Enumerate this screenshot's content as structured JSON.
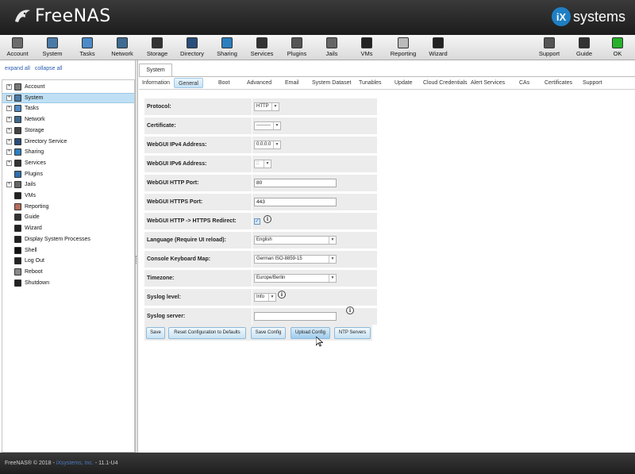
{
  "header": {
    "app_name": "FreeNAS",
    "vendor_name": "systems",
    "vendor_badge": "iX"
  },
  "toolbar": {
    "items": [
      {
        "label": "Account",
        "icon": "account-icon",
        "color": "#6b6b6b"
      },
      {
        "label": "System",
        "icon": "system-icon",
        "color": "#4a7aa8"
      },
      {
        "label": "Tasks",
        "icon": "tasks-icon",
        "color": "#4c8bc8"
      },
      {
        "label": "Network",
        "icon": "network-icon",
        "color": "#3d6b91"
      },
      {
        "label": "Storage",
        "icon": "storage-icon",
        "color": "#333333"
      },
      {
        "label": "Directory",
        "icon": "directory-icon",
        "color": "#2a4d7a"
      },
      {
        "label": "Sharing",
        "icon": "sharing-icon",
        "color": "#2b7ebf"
      },
      {
        "label": "Services",
        "icon": "services-icon",
        "color": "#333333"
      },
      {
        "label": "Plugins",
        "icon": "plugins-icon",
        "color": "#555555"
      },
      {
        "label": "Jails",
        "icon": "jails-icon",
        "color": "#666666"
      },
      {
        "label": "VMs",
        "icon": "vms-icon",
        "color": "#222222"
      },
      {
        "label": "Reporting",
        "icon": "reporting-icon",
        "color": "#bbbbbb"
      },
      {
        "label": "Wizard",
        "icon": "wizard-icon",
        "color": "#222222"
      },
      {
        "label": "Support",
        "icon": "support-icon",
        "color": "#555555"
      },
      {
        "label": "Guide",
        "icon": "guide-icon",
        "color": "#333333"
      },
      {
        "label": "OK",
        "icon": "ok-status-icon",
        "color": "#27b12b"
      }
    ]
  },
  "tree": {
    "expand_all": "expand all",
    "collapse_all": "collapse all",
    "items": [
      {
        "label": "Account",
        "expandable": true,
        "icon": "account-icon",
        "color": "#777777"
      },
      {
        "label": "System",
        "expandable": true,
        "icon": "system-icon",
        "color": "#4a7aa8",
        "selected": true
      },
      {
        "label": "Tasks",
        "expandable": true,
        "icon": "tasks-icon",
        "color": "#4c8bc8"
      },
      {
        "label": "Network",
        "expandable": true,
        "icon": "network-icon",
        "color": "#3d6b91"
      },
      {
        "label": "Storage",
        "expandable": true,
        "icon": "storage-icon",
        "color": "#444444"
      },
      {
        "label": "Directory Service",
        "expandable": true,
        "icon": "directory-icon",
        "color": "#2a4d7a"
      },
      {
        "label": "Sharing",
        "expandable": true,
        "icon": "sharing-icon",
        "color": "#2b7ebf"
      },
      {
        "label": "Services",
        "expandable": true,
        "icon": "services-icon",
        "color": "#333333"
      },
      {
        "label": "Plugins",
        "expandable": false,
        "icon": "plugins-icon",
        "color": "#2f6fae"
      },
      {
        "label": "Jails",
        "expandable": true,
        "icon": "jails-icon",
        "color": "#666666"
      },
      {
        "label": "VMs",
        "expandable": false,
        "icon": "vms-icon",
        "color": "#222222"
      },
      {
        "label": "Reporting",
        "expandable": false,
        "icon": "reporting-icon",
        "color": "#b56b5a"
      },
      {
        "label": "Guide",
        "expandable": false,
        "icon": "guide-icon",
        "color": "#333333"
      },
      {
        "label": "Wizard",
        "expandable": false,
        "icon": "wizard-icon",
        "color": "#222222"
      },
      {
        "label": "Display System Processes",
        "expandable": false,
        "icon": "processes-icon",
        "color": "#222222"
      },
      {
        "label": "Shell",
        "expandable": false,
        "icon": "shell-icon",
        "color": "#111111"
      },
      {
        "label": "Log Out",
        "expandable": false,
        "icon": "logout-icon",
        "color": "#222222"
      },
      {
        "label": "Reboot",
        "expandable": false,
        "icon": "reboot-icon",
        "color": "#888888"
      },
      {
        "label": "Shutdown",
        "expandable": false,
        "icon": "shutdown-icon",
        "color": "#222222"
      }
    ]
  },
  "main": {
    "top_tab": "System",
    "subtabs": [
      {
        "label": "Information"
      },
      {
        "label": "General",
        "active": true
      },
      {
        "label": "Boot"
      },
      {
        "label": "Advanced"
      },
      {
        "label": "Email"
      },
      {
        "label": "System Dataset"
      },
      {
        "label": "Tunables"
      },
      {
        "label": "Update"
      },
      {
        "label": "Cloud Credentials"
      },
      {
        "label": "Alert Services"
      },
      {
        "label": "CAs"
      },
      {
        "label": "Certificates"
      },
      {
        "label": "Support"
      }
    ]
  },
  "form": {
    "protocol": {
      "label": "Protocol:",
      "value": "HTTP"
    },
    "certificate": {
      "label": "Certificate:",
      "value": "---------"
    },
    "ipv4": {
      "label": "WebGUI IPv4 Address:",
      "value": "0.0.0.0"
    },
    "ipv6": {
      "label": "WebGUI IPv6 Address:",
      "value": "::"
    },
    "http_port": {
      "label": "WebGUI HTTP Port:",
      "value": "80"
    },
    "https_port": {
      "label": "WebGUI HTTPS Port:",
      "value": "443"
    },
    "redirect": {
      "label": "WebGUI HTTP -> HTTPS Redirect:",
      "checked": true,
      "check_glyph": "✓"
    },
    "language": {
      "label": "Language (Require UI reload):",
      "value": "English"
    },
    "keyboard": {
      "label": "Console Keyboard Map:",
      "value": "German ISO-8859-15"
    },
    "timezone": {
      "label": "Timezone:",
      "value": "Europe/Berlin"
    },
    "syslog_level": {
      "label": "Syslog level:",
      "value": "Info"
    },
    "syslog_server": {
      "label": "Syslog server:",
      "value": ""
    }
  },
  "buttons": {
    "save": "Save",
    "reset": "Reset Configuration to Defaults",
    "save_config": "Save Config",
    "upload_config": "Upload Config",
    "ntp": "NTP Servers"
  },
  "footer": {
    "copyright": "FreeNAS® © 2018 - ",
    "company": "iXsystems, Inc.",
    "version": " - 11.1-U4"
  }
}
